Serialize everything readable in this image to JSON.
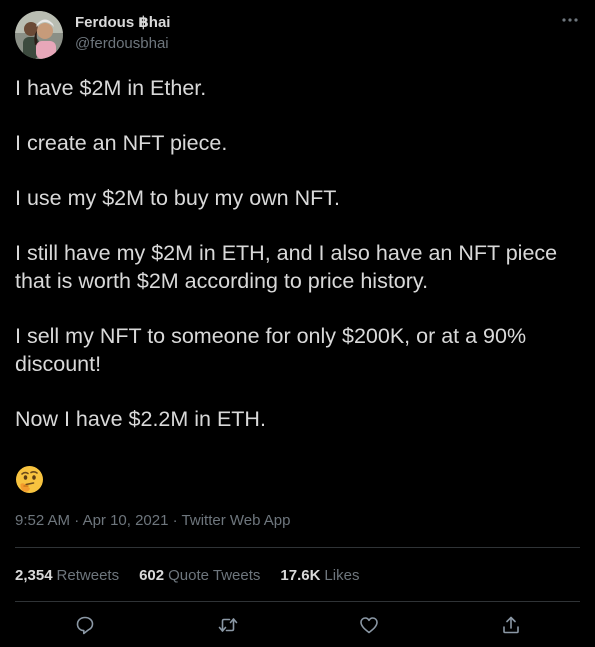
{
  "author": {
    "display_name": "Ferdous ฿hai",
    "handle": "@ferdousbhai",
    "avatar_icon": "avatar-photo-icon"
  },
  "tweet": {
    "paragraphs": [
      "I have $2M in Ether.",
      "I create an NFT piece.",
      "I use my $2M to buy my own NFT.",
      "I still have my $2M in ETH, and I also have an NFT piece that is worth $2M according to price history.",
      "I sell my NFT to someone for only $200K, or at a 90% discount!",
      "Now I have $2.2M in ETH."
    ],
    "emoji_icon": "thinking-face-emoji",
    "time": "9:52 AM",
    "date": "Apr 10, 2021",
    "source": "Twitter Web App",
    "separator": "·"
  },
  "stats": {
    "retweets": {
      "count": "2,354",
      "label": "Retweets"
    },
    "quote_tweets": {
      "count": "602",
      "label": "Quote Tweets"
    },
    "likes": {
      "count": "17.6K",
      "label": "Likes"
    }
  },
  "actions": {
    "icons": [
      "reply-icon",
      "retweet-icon",
      "like-icon",
      "share-icon"
    ]
  },
  "colors": {
    "background": "#000000",
    "text": "#d9d9d9",
    "secondary": "#6e767d",
    "divider": "#2f3336"
  }
}
